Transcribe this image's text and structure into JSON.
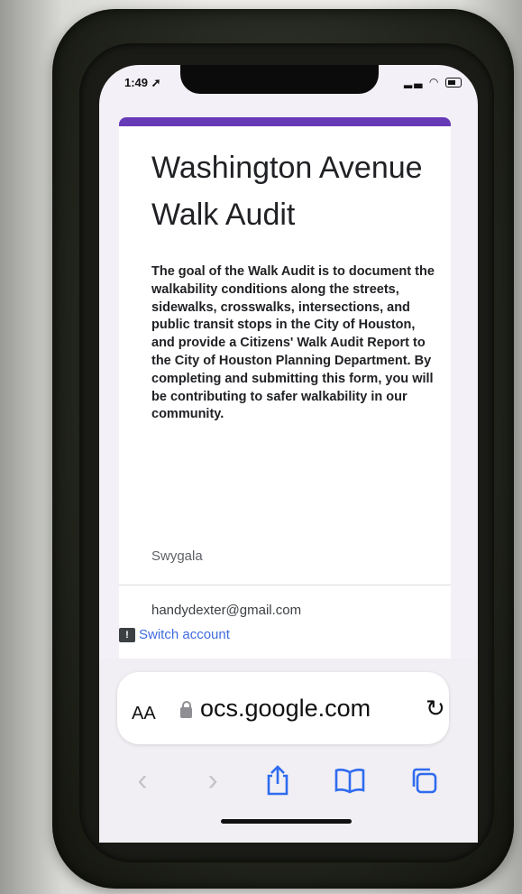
{
  "status_bar": {
    "time": "1:49",
    "location_glyph": "➚",
    "icons": [
      "signal-icon",
      "wifi-icon",
      "battery-icon"
    ]
  },
  "form": {
    "accent_color": "#673ab7",
    "title": "Washington Avenue Walk Audit",
    "description": "The goal of the Walk Audit is to document the walkability conditions along the streets, sidewalks, crosswalks, intersections, and public transit stops in the City of Houston, and provide a Citizens' Walk Audit Report to the City of Houston Planning Department. By completing and submitting this form, you will be contributing to safer walkability in our community.",
    "owner": "Swygala",
    "account_email": "handydexter@gmail.com",
    "switch_account_label": "Switch account",
    "link_color": "#3f6be0"
  },
  "browser": {
    "text_size_label": "AA",
    "url_text": "ocs.google.com",
    "reload_glyph": "↻",
    "nav": {
      "back_glyph": "‹",
      "forward_glyph": "›",
      "share_icon": "share-icon",
      "bookmarks_icon": "bookmarks-icon",
      "tabs_icon": "tabs-icon"
    }
  }
}
